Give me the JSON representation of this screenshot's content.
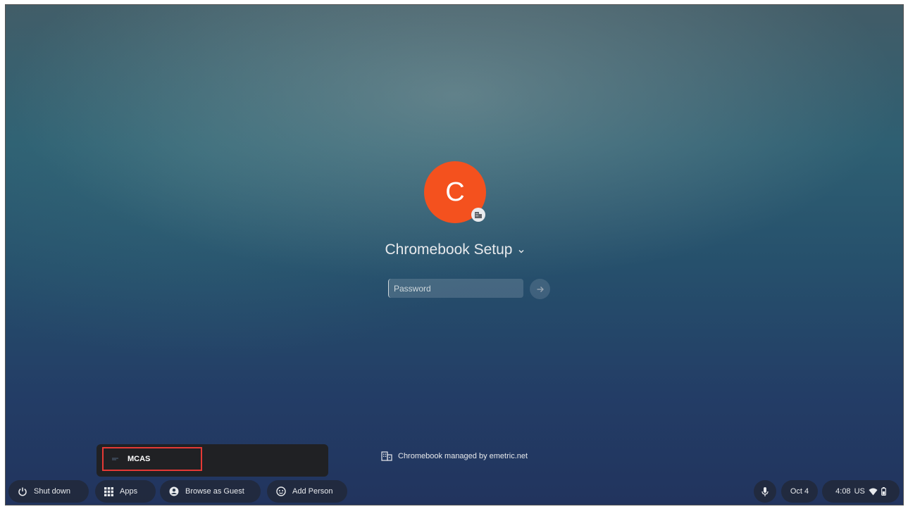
{
  "user": {
    "avatar_letter": "C",
    "name": "Chromebook Setup",
    "avatar_color": "#f4511e"
  },
  "password": {
    "placeholder": "Password",
    "value": ""
  },
  "managed_note": "Chromebook managed by emetric.net",
  "apps_popup": {
    "items": [
      {
        "label": "MCAS",
        "icon": "app-icon"
      }
    ]
  },
  "shelf": {
    "shutdown_label": "Shut down",
    "apps_label": "Apps",
    "guest_label": "Browse as Guest",
    "add_person_label": "Add Person"
  },
  "tray": {
    "date": "Oct 4",
    "time": "4:08",
    "locale": "US"
  },
  "colors": {
    "highlight_border": "#e53935",
    "popup_background": "#202124"
  }
}
